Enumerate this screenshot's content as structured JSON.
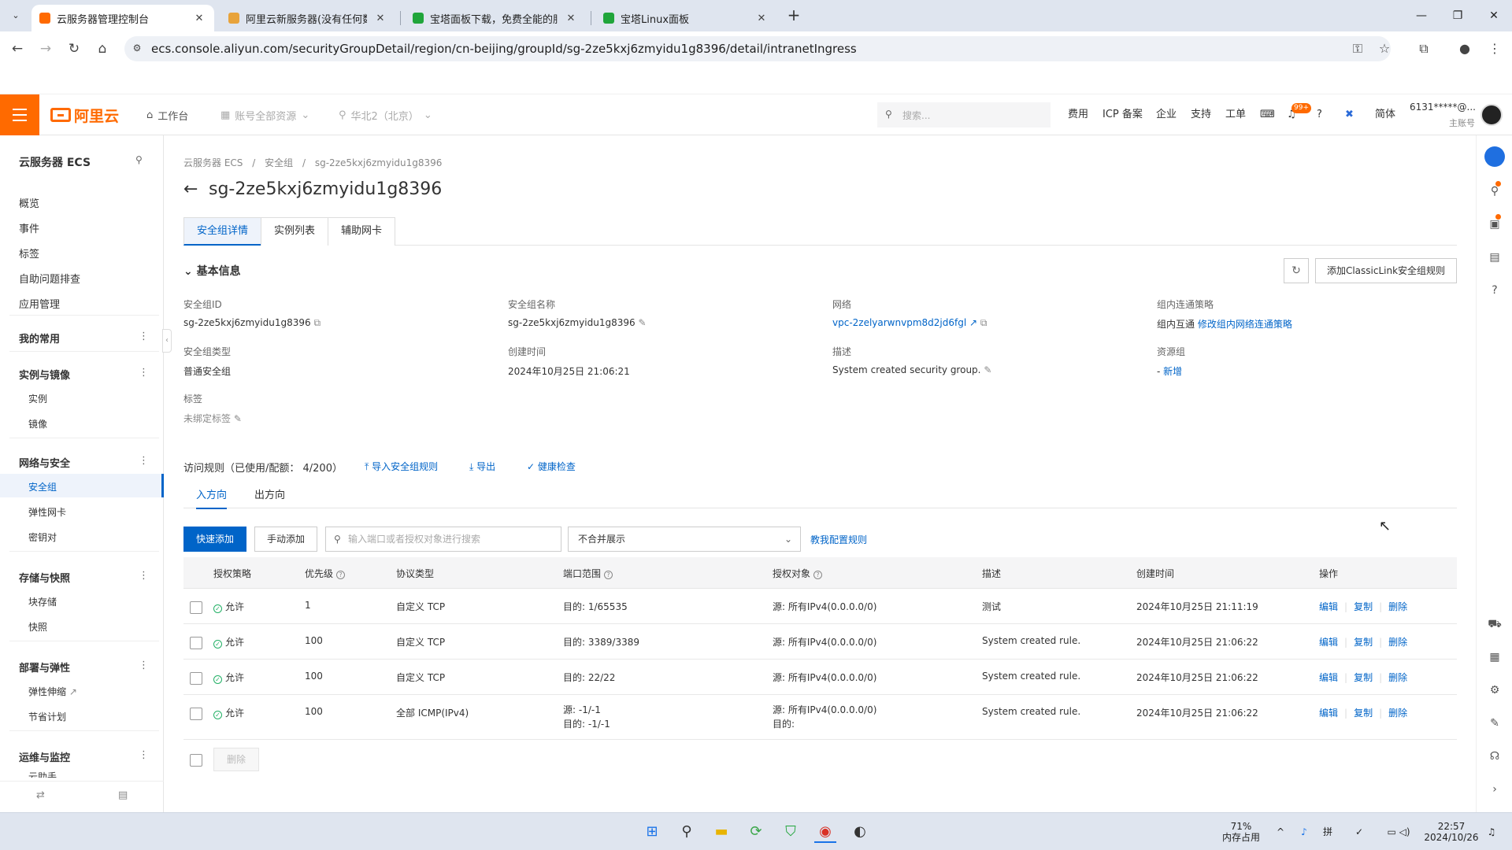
{
  "browser": {
    "tabs": [
      {
        "title": "云服务器管理控制台",
        "color": "#ff6a00",
        "active": true
      },
      {
        "title": "阿里云新服务器(没有任何数据)",
        "color": "#e8a33b",
        "active": false
      },
      {
        "title": "宝塔面板下载，免费全能的服务",
        "color": "#20a53a",
        "active": false
      },
      {
        "title": "宝塔Linux面板",
        "color": "#20a53a",
        "active": false
      }
    ],
    "url": "ecs.console.aliyun.com/securityGroupDetail/region/cn-beijing/groupId/sg-2ze5kxj6zmyidu1g8396/detail/intranetIngress"
  },
  "topnav": {
    "logo_text": "阿里云",
    "workbench": "工作台",
    "account_scope": "账号全部资源",
    "region": "华北2（北京）",
    "search_placeholder": "搜索...",
    "links": [
      "费用",
      "ICP 备案",
      "企业",
      "支持",
      "工单"
    ],
    "badge": "99+",
    "lang": "简体",
    "account": "6131*****@...",
    "account_role": "主账号"
  },
  "sidebar": {
    "title": "云服务器 ECS",
    "top_items": [
      "概览",
      "事件",
      "标签",
      "自助问题排查",
      "应用管理"
    ],
    "favorites": "我的常用",
    "groups": [
      {
        "title": "实例与镜像",
        "items": [
          "实例",
          "镜像"
        ]
      },
      {
        "title": "网络与安全",
        "items": [
          "安全组",
          "弹性网卡",
          "密钥对"
        ]
      },
      {
        "title": "存储与快照",
        "items": [
          "块存储",
          "快照"
        ]
      },
      {
        "title": "部署与弹性",
        "items": [
          "弹性伸缩",
          "节省计划"
        ]
      },
      {
        "title": "运维与监控",
        "items": [
          "云助手"
        ]
      }
    ],
    "active_item": "安全组"
  },
  "main": {
    "breadcrumb": [
      "云服务器 ECS",
      "/",
      "安全组",
      "/",
      "sg-2ze5kxj6zmyidu1g8396"
    ],
    "title": "sg-2ze5kxj6zmyidu1g8396",
    "tabs": [
      "安全组详情",
      "实例列表",
      "辅助网卡"
    ],
    "basic_info_title": "基本信息",
    "classiclink_button": "添加ClassicLink安全组规则",
    "fields": {
      "sg_id_label": "安全组ID",
      "sg_id": "sg-2ze5kxj6zmyidu1g8396",
      "sg_name_label": "安全组名称",
      "sg_name": "sg-2ze5kxj6zmyidu1g8396",
      "network_label": "网络",
      "network": "vpc-2zelyarwnvpm8d2jd6fgl",
      "policy_label": "组内连通策略",
      "policy": "组内互通",
      "policy_link": "修改组内网络连通策略",
      "type_label": "安全组类型",
      "type": "普通安全组",
      "created_label": "创建时间",
      "created": "2024年10月25日 21:06:21",
      "desc_label": "描述",
      "desc": "System created security group.",
      "rg_label": "资源组",
      "rg_dash": "-",
      "rg_link": "新增",
      "tags_label": "标签",
      "tags": "未绑定标签"
    },
    "rules_head": "访问规则（已使用/配额：  4/200）",
    "rules_links": [
      "导入安全组规则",
      "导出",
      "健康检查"
    ],
    "dir_tabs": [
      "入方向",
      "出方向"
    ],
    "quick_add": "快速添加",
    "manual_add": "手动添加",
    "search_placeholder": "输入端口或者授权对象进行搜索",
    "merge_select": "不合并展示",
    "teach_link": "教我配置规则",
    "columns": [
      "授权策略",
      "优先级",
      "协议类型",
      "端口范围",
      "授权对象",
      "描述",
      "创建时间",
      "操作"
    ],
    "rows": [
      {
        "policy": "允许",
        "priority": "1",
        "proto": "自定义 TCP",
        "port": "目的: 1/65535",
        "port2": "",
        "obj": "源: 所有IPv4(0.0.0.0/0)",
        "obj2": "",
        "desc": "测试",
        "time": "2024年10月25日 21:11:19"
      },
      {
        "policy": "允许",
        "priority": "100",
        "proto": "自定义 TCP",
        "port": "目的: 3389/3389",
        "port2": "",
        "obj": "源: 所有IPv4(0.0.0.0/0)",
        "obj2": "",
        "desc": "System created rule.",
        "time": "2024年10月25日 21:06:22"
      },
      {
        "policy": "允许",
        "priority": "100",
        "proto": "自定义 TCP",
        "port": "目的: 22/22",
        "port2": "",
        "obj": "源: 所有IPv4(0.0.0.0/0)",
        "obj2": "",
        "desc": "System created rule.",
        "time": "2024年10月25日 21:06:22"
      },
      {
        "policy": "允许",
        "priority": "100",
        "proto": "全部 ICMP(IPv4)",
        "port": "源: -1/-1",
        "port2": "目的: -1/-1",
        "obj": "源: 所有IPv4(0.0.0.0/0)",
        "obj2": "目的:",
        "desc": "System created rule.",
        "time": "2024年10月25日 21:06:22"
      }
    ],
    "ops": [
      "编辑",
      "复制",
      "删除"
    ],
    "delete_button": "删除"
  },
  "taskbar": {
    "mem_percent": "71%",
    "mem_label": "内存占用",
    "time": "22:57",
    "date": "2024/10/26"
  }
}
